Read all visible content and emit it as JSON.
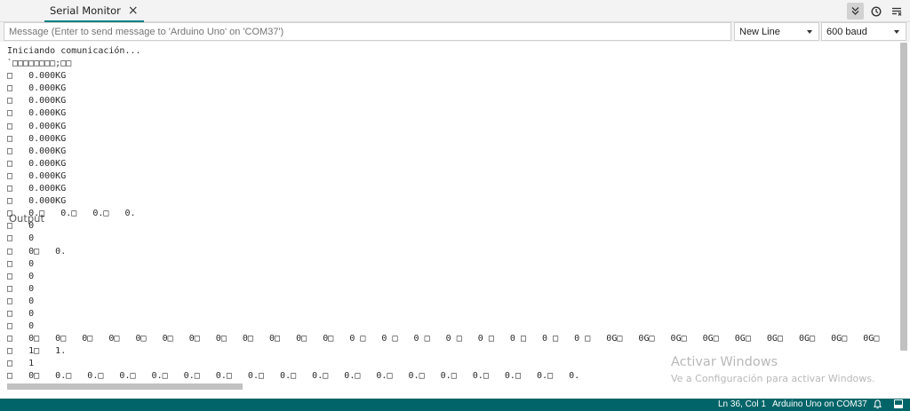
{
  "tabs": {
    "output_label": "Output",
    "serial_label": "Serial Monitor",
    "close_glyph": "×"
  },
  "input": {
    "placeholder": "Message (Enter to send message to 'Arduino Uno' on 'COM37')",
    "line_ending": "New Line",
    "baud": "600 baud"
  },
  "output_lines": [
    "Iniciando comunicación...",
    "`□□□□□□□□;□□",
    "□   0.000KG",
    "□   0.000KG",
    "□   0.000KG",
    "□   0.000KG",
    "□   0.000KG",
    "□   0.000KG",
    "□   0.000KG",
    "□   0.000KG",
    "□   0.000KG",
    "□   0.000KG",
    "□   0.000KG",
    "□   0.□   0.□   0.□   0.",
    "□   0",
    "□   0",
    "□   0□   0.",
    "□   0",
    "□   0",
    "□   0",
    "□   0",
    "□   0",
    "□   0",
    "□   0□   0□   0□   0□   0□   0□   0□   0□   0□   0□   0□   0□   0 □   0 □   0 □   0 □   0 □   0 □   0 □   0 □   0G□   0G□   0G□   0G□   0G□   0G□   0G□   0G□   0G□",
    "□   1□   1.",
    "□   1",
    "□   0□   0.□   0.□   0.□   0.□   0.□   0.□   0.□   0.□   0.□   0.□   0.□   0.□   0.□   0.□   0.□   0.□   0."
  ],
  "watermark": {
    "title": "Activar Windows",
    "subtitle": "Ve a Configuración para activar Windows."
  },
  "status": {
    "position": "Ln 36, Col 1",
    "board": "Arduino Uno on COM37"
  },
  "icons": {
    "autoscroll": "double-chevron-down-icon",
    "timestamp": "clock-icon",
    "clear": "clear-output-icon",
    "notifications": "bell-icon",
    "panel": "panel-icon"
  },
  "colors": {
    "accent": "#008184",
    "statusbar": "#006468",
    "watermark": "#b8b8b8"
  }
}
